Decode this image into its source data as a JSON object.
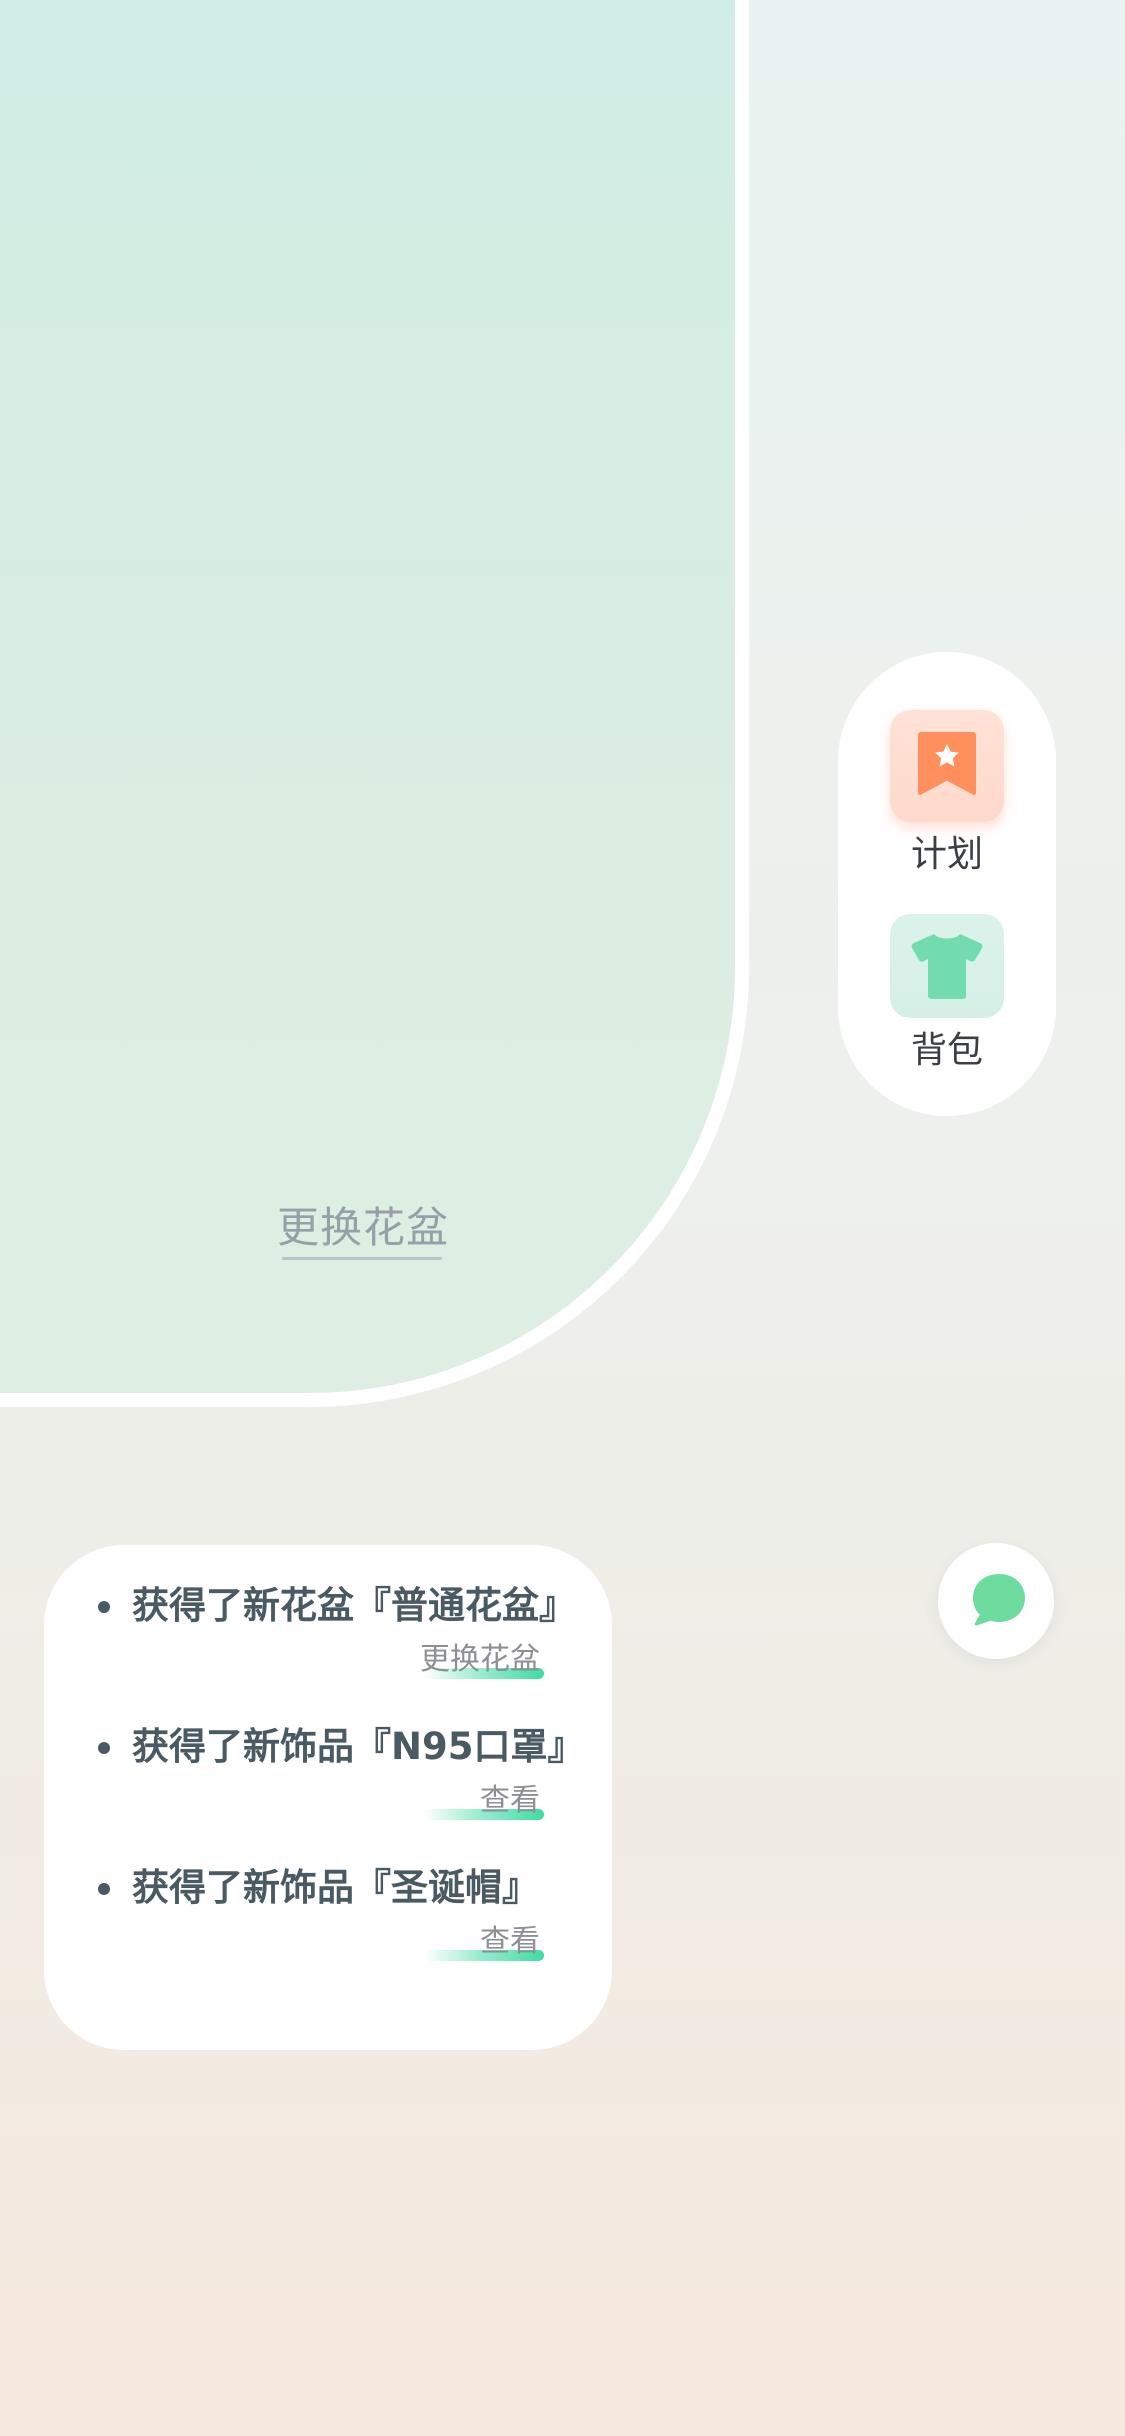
{
  "plant": {
    "change_pot_link": "更换花盆"
  },
  "side_menu": {
    "items": [
      {
        "label": "计划",
        "icon": "bookmark-star-icon",
        "color": "#ff8f5c"
      },
      {
        "label": "背包",
        "icon": "tshirt-icon",
        "color": "#72dcae"
      }
    ]
  },
  "chat_button": {
    "icon": "chat-bubble-icon",
    "color": "#6edc9e"
  },
  "notifications": [
    {
      "text": "获得了新花盆『普通花盆』",
      "action": "更换花盆"
    },
    {
      "text": "获得了新饰品『N95口罩』",
      "action": "查看"
    },
    {
      "text": "获得了新饰品『圣诞帽』",
      "action": "查看"
    }
  ],
  "colors": {
    "accent_green": "#3fdca3",
    "text_dark": "#4a5a63",
    "plan_orange": "#ff8f5c"
  }
}
